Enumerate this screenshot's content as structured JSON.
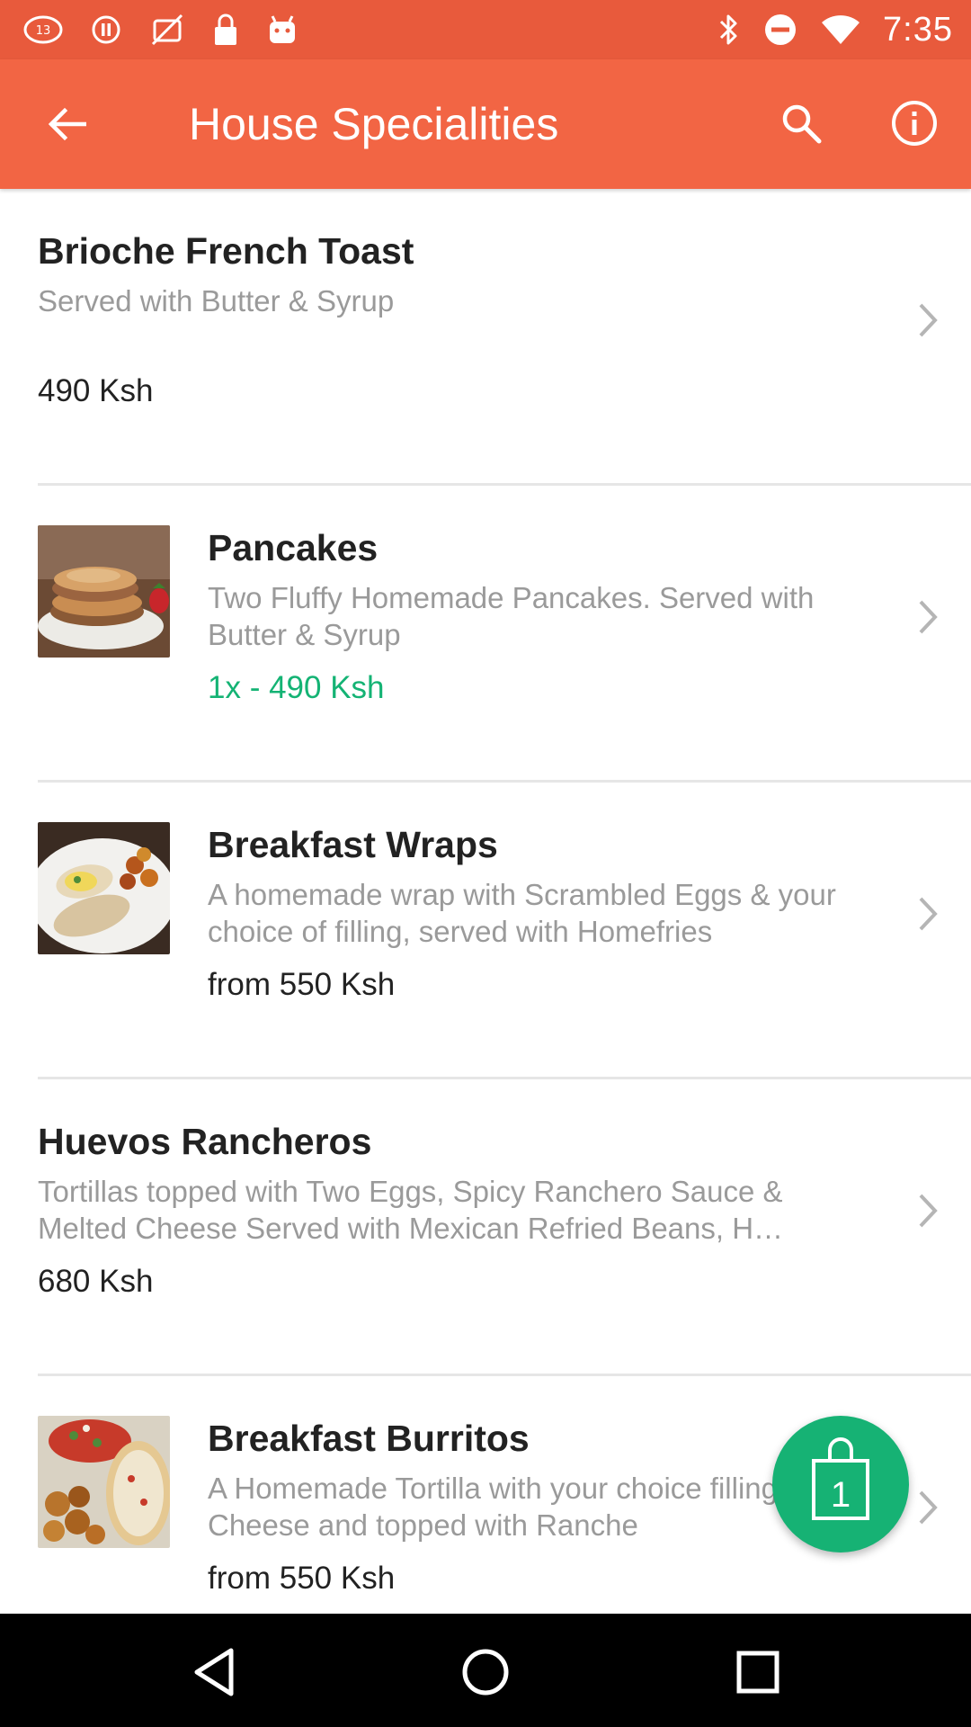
{
  "status_bar": {
    "time": "7:35",
    "left_icons": [
      "news-icon",
      "sync-icon",
      "no-photo-icon",
      "lock-icon",
      "android-icon"
    ],
    "right_icons": [
      "bluetooth-icon",
      "do-not-disturb-icon",
      "wifi-icon"
    ]
  },
  "app_bar": {
    "title": "House Specialities",
    "background": "#f26544",
    "status_background": "#e85a3c"
  },
  "items": [
    {
      "name": "Brioche French Toast",
      "description": "Served with Butter & Syrup",
      "price": "490 Ksh",
      "has_image": false,
      "in_cart": false
    },
    {
      "name": "Pancakes",
      "description": "Two Fluffy Homemade Pancakes. Served with Butter & Syrup",
      "price": "1x - 490 Ksh",
      "has_image": true,
      "image": "pancakes-photo",
      "in_cart": true
    },
    {
      "name": "Breakfast Wraps",
      "description": "A homemade wrap with Scrambled Eggs & your choice of filling, served with Homefries",
      "price": "from 550 Ksh",
      "has_image": true,
      "image": "wraps-photo",
      "in_cart": false
    },
    {
      "name": "Huevos Rancheros",
      "description": "Tortillas topped with Two Eggs, Spicy Ranchero Sauce & Melted Cheese Served with Mexican Refried Beans, H…",
      "price": "680 Ksh",
      "has_image": false,
      "in_cart": false
    },
    {
      "name": "Breakfast Burritos",
      "description": "A Homemade Tortilla with your choice filling, Cheese and topped with Ranche",
      "price": "from 550 Ksh",
      "has_image": true,
      "image": "burritos-photo",
      "in_cart": false
    }
  ],
  "cart": {
    "count": "1",
    "color": "#16b274"
  },
  "colors": {
    "accent": "#f26544",
    "in_cart_price": "#14b374",
    "description": "#9a9a9a"
  }
}
